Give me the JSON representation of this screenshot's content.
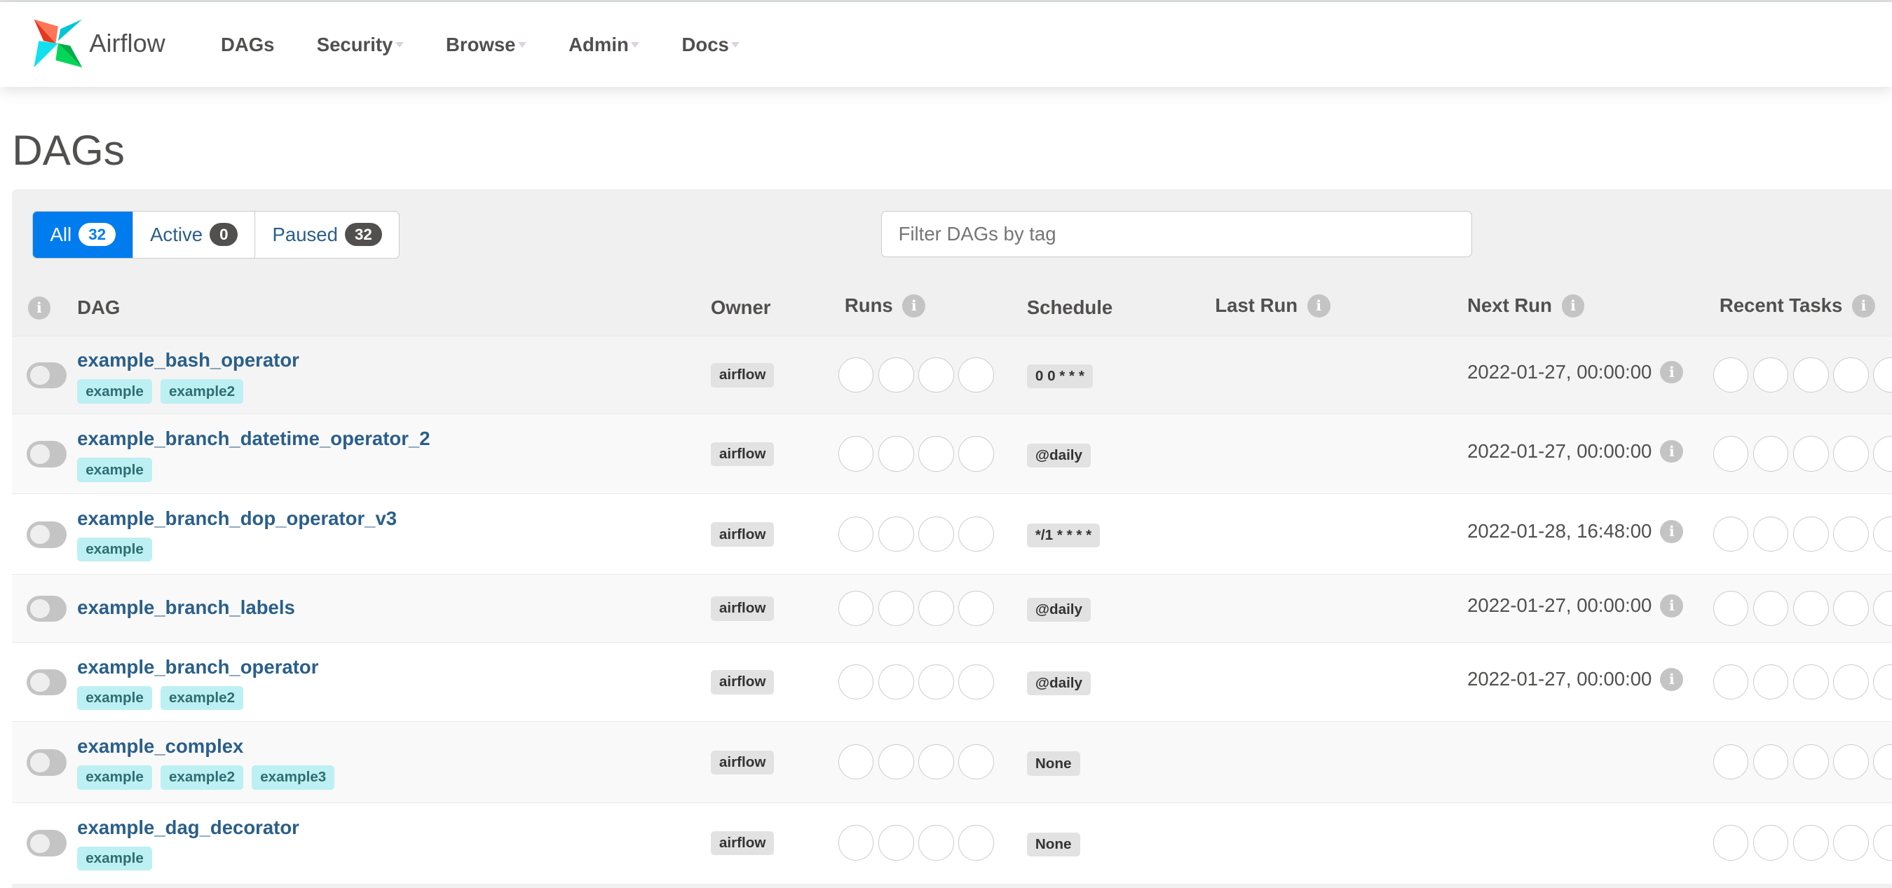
{
  "app": {
    "name": "Airflow"
  },
  "nav": {
    "items": [
      {
        "label": "DAGs",
        "dropdown": false
      },
      {
        "label": "Security",
        "dropdown": true
      },
      {
        "label": "Browse",
        "dropdown": true
      },
      {
        "label": "Admin",
        "dropdown": true
      },
      {
        "label": "Docs",
        "dropdown": true
      }
    ]
  },
  "page": {
    "title": "DAGs"
  },
  "filters": {
    "all": {
      "label": "All",
      "count": "32"
    },
    "active": {
      "label": "Active",
      "count": "0"
    },
    "paused": {
      "label": "Paused",
      "count": "32"
    },
    "tag_placeholder": "Filter DAGs by tag"
  },
  "table": {
    "headers": {
      "dag": "DAG",
      "owner": "Owner",
      "runs": "Runs",
      "schedule": "Schedule",
      "last_run": "Last Run",
      "next_run": "Next Run",
      "recent_tasks": "Recent Tasks"
    },
    "rows": [
      {
        "name": "example_bash_operator",
        "tags": [
          "example",
          "example2"
        ],
        "owner": "airflow",
        "schedule": "0 0 * * *",
        "next_run": "2022-01-27, 00:00:00",
        "paused": true
      },
      {
        "name": "example_branch_datetime_operator_2",
        "tags": [
          "example"
        ],
        "owner": "airflow",
        "schedule": "@daily",
        "next_run": "2022-01-27, 00:00:00",
        "paused": true
      },
      {
        "name": "example_branch_dop_operator_v3",
        "tags": [
          "example"
        ],
        "owner": "airflow",
        "schedule": "*/1 * * * *",
        "next_run": "2022-01-28, 16:48:00",
        "paused": true
      },
      {
        "name": "example_branch_labels",
        "tags": [],
        "owner": "airflow",
        "schedule": "@daily",
        "next_run": "2022-01-27, 00:00:00",
        "paused": true
      },
      {
        "name": "example_branch_operator",
        "tags": [
          "example",
          "example2"
        ],
        "owner": "airflow",
        "schedule": "@daily",
        "next_run": "2022-01-27, 00:00:00",
        "paused": true
      },
      {
        "name": "example_complex",
        "tags": [
          "example",
          "example2",
          "example3"
        ],
        "owner": "airflow",
        "schedule": "None",
        "next_run": "",
        "paused": true
      },
      {
        "name": "example_dag_decorator",
        "tags": [
          "example"
        ],
        "owner": "airflow",
        "schedule": "None",
        "next_run": "",
        "paused": true
      }
    ]
  },
  "colors": {
    "accent": "#017cee",
    "link": "#2a5f8a",
    "tag_bg": "#bdf0f3"
  }
}
